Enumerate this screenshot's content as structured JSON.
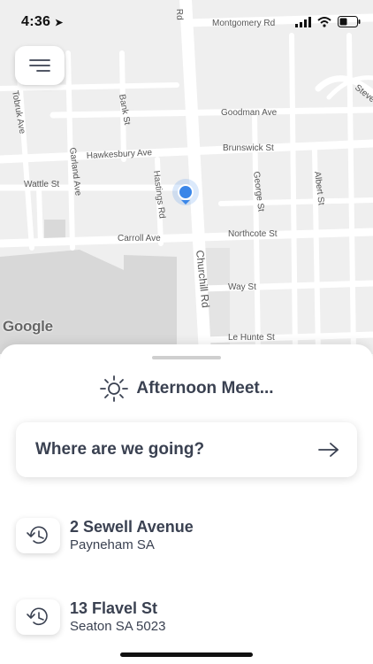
{
  "status_bar": {
    "time": "4:36"
  },
  "map": {
    "attribution": "Google",
    "streets": [
      "Rd",
      "Montgomery Rd",
      "Goodman Ave",
      "Brunswick St",
      "Hawkesbury Ave",
      "Wattle St",
      "Carroll Ave",
      "Northcote St",
      "Way St",
      "Le Hunte St",
      "Tobruk Ave",
      "Bank St",
      "Garland Ave",
      "Hastings Rd",
      "George St",
      "Albert St",
      "Churchill Rd",
      "Steve..."
    ]
  },
  "sheet": {
    "greeting": "Afternoon Meet...",
    "search_placeholder": "Where are we going?",
    "recents": [
      {
        "title": "2 Sewell Avenue",
        "subtitle": "Payneham SA"
      },
      {
        "title": "13 Flavel St",
        "subtitle": "Seaton SA 5023"
      }
    ]
  },
  "colors": {
    "accent": "#3a86e8",
    "text": "#3a4151"
  }
}
